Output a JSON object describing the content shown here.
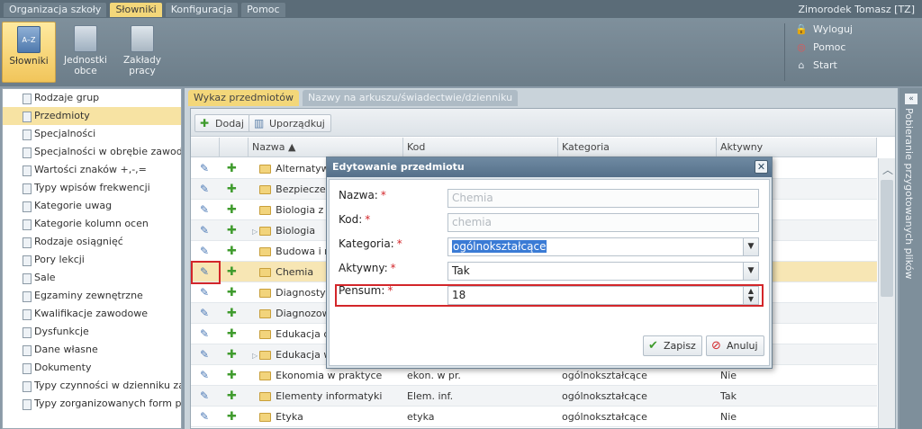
{
  "topmenu": {
    "items": [
      "Organizacja szkoły",
      "Słowniki",
      "Konfiguracja",
      "Pomoc"
    ],
    "user": "Zimorodek Tomasz [TZ]"
  },
  "ribbon": {
    "buttons": [
      {
        "label": "Słowniki",
        "icon": "dictionary-icon"
      },
      {
        "label": "Jednostki obce",
        "icon": "building-icon"
      },
      {
        "label": "Zakłady pracy",
        "icon": "briefcase-icon"
      }
    ],
    "links": [
      {
        "label": "Wyloguj",
        "icon": "lock-icon"
      },
      {
        "label": "Pomoc",
        "icon": "lifebuoy-icon"
      },
      {
        "label": "Start",
        "icon": "home-icon"
      }
    ]
  },
  "sidebar": {
    "items": [
      "Rodzaje grup",
      "Przedmioty",
      "Specjalności",
      "Specjalności w obrębie zawodu, s",
      "Wartości znaków +,-,=",
      "Typy wpisów frekwencji",
      "Kategorie uwag",
      "Kategorie kolumn ocen",
      "Rodzaje osiągnięć",
      "Pory lekcji",
      "Sale",
      "Egzaminy zewnętrzne",
      "Kwalifikacje zawodowe",
      "Dysfunkcje",
      "Dane własne",
      "Dokumenty",
      "Typy czynności w dzienniku zajęć",
      "Typy zorganizowanych form pomc"
    ]
  },
  "main": {
    "tabs": [
      "Wykaz przedmiotów",
      "Nazwy na arkuszu/świadectwie/dzienniku"
    ],
    "toolbar": {
      "add": "Dodaj",
      "sort": "Uporządkuj"
    },
    "columns": [
      "Nazwa ▲",
      "Kod",
      "Kategoria",
      "Aktywny"
    ],
    "rows": [
      {
        "name": "Alternatyw",
        "code": "",
        "category": "",
        "active": ""
      },
      {
        "name": "Bezpieczer",
        "code": "",
        "category": "",
        "active": ""
      },
      {
        "name": "Biologia z",
        "code": "",
        "category": "",
        "active": ""
      },
      {
        "name": "Biologia",
        "code": "",
        "category": "",
        "active": ""
      },
      {
        "name": "Budowa i r",
        "code": "",
        "category": "",
        "active": ""
      },
      {
        "name": "Chemia",
        "code": "",
        "category": "",
        "active": ""
      },
      {
        "name": "Diagnostyk",
        "code": "",
        "category": "",
        "active": ""
      },
      {
        "name": "Diagnozow",
        "code": "",
        "category": "",
        "active": ""
      },
      {
        "name": "Edukacja c",
        "code": "",
        "category": "",
        "active": ""
      },
      {
        "name": "Edukacja w",
        "code": "",
        "category": "",
        "active": ""
      },
      {
        "name": "Ekonomia w praktyce",
        "code": "ekon. w pr.",
        "category": "ogólnokształcące",
        "active": "Nie"
      },
      {
        "name": "Elementy informatyki",
        "code": "Elem. inf.",
        "category": "ogólnokształcące",
        "active": "Tak"
      },
      {
        "name": "Etyka",
        "code": "etyka",
        "category": "ogólnokształcące",
        "active": "Nie"
      }
    ]
  },
  "rightpanel": {
    "label": "Pobieranie przygotowanych plików"
  },
  "modal": {
    "title": "Edytowanie przedmiotu",
    "fields": {
      "name_label": "Nazwa:",
      "name_value": "Chemia",
      "code_label": "Kod:",
      "code_value": "chemia",
      "category_label": "Kategoria:",
      "category_value": "ogólnokształcące",
      "active_label": "Aktywny:",
      "active_value": "Tak",
      "pensum_label": "Pensum:",
      "pensum_value": "18",
      "required_mark": "*"
    },
    "save": "Zapisz",
    "cancel": "Anuluj"
  },
  "colors": {
    "accent": "#f3d77a",
    "highlight": "#d3262a",
    "header": "#5b6c78"
  }
}
